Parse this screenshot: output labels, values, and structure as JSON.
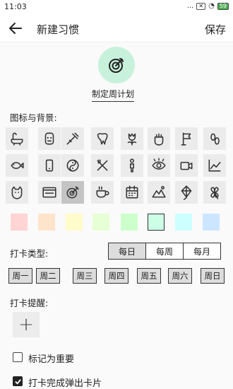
{
  "status_bar": {
    "time": "11:03",
    "dots": "...",
    "battery": "59"
  },
  "header": {
    "title": "新建习惯",
    "save_label": "保存"
  },
  "plan": {
    "label": "制定周计划"
  },
  "icons_section": {
    "label": "图标与背景:",
    "icons": [
      "bathtub-icon",
      "face-icon",
      "syringe-icon",
      "tooth-icon",
      "tulip-icon",
      "fist-icon",
      "flag-icon",
      "footprint-icon",
      "fish-icon",
      "phone-icon",
      "yin-yang-icon",
      "utensils-icon",
      "person-icon",
      "eye-icon",
      "camera-icon",
      "chart-icon",
      "cat-icon",
      "browser-icon",
      "target-icon",
      "coffee-icon",
      "calendar-icon",
      "mountain-icon",
      "kite-icon",
      "clover-icon"
    ],
    "selected_icon": "target-icon",
    "colors": [
      "#ffd4d4",
      "#ffe4cc",
      "#fffccc",
      "#e6ffd4",
      "#ccffcc",
      "#ccffe6",
      "#ccffff",
      "#cce6ff"
    ],
    "selected_color": 5
  },
  "checkin_type": {
    "label": "打卡类型:",
    "options": [
      "每日",
      "每周",
      "每月"
    ],
    "selected": "每日"
  },
  "weekdays": [
    "周一",
    "周二",
    "周三",
    "周四",
    "周五",
    "周六",
    "周日"
  ],
  "reminder": {
    "label": "打卡提醒:",
    "add_symbol": "+"
  },
  "options": {
    "important": {
      "label": "标记为重要",
      "checked": false
    },
    "popup_card": {
      "label": "打卡完成弹出卡片",
      "checked": true
    }
  }
}
